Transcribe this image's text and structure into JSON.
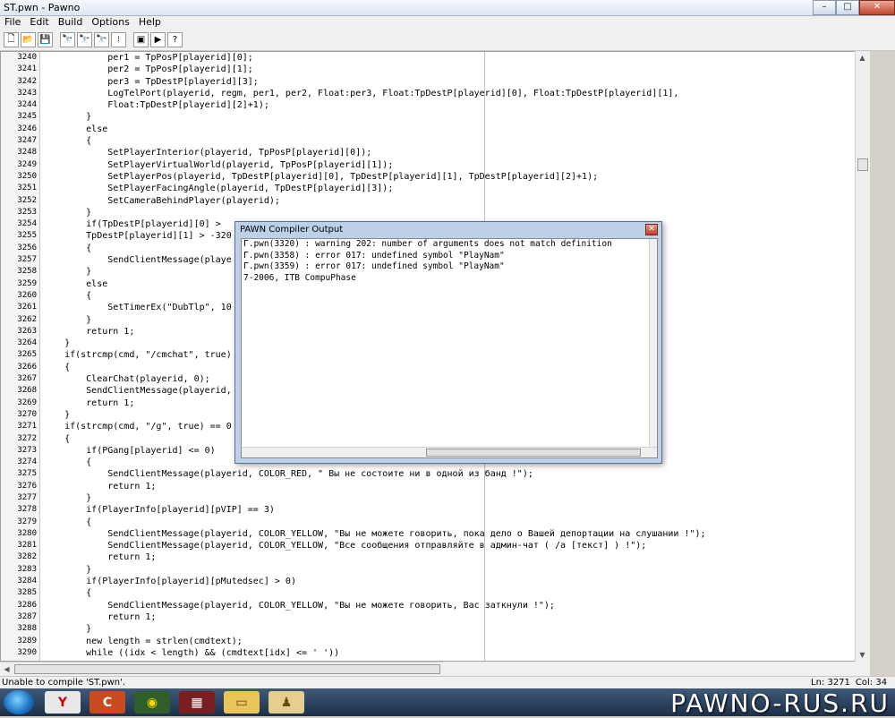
{
  "window": {
    "title": "ST.pwn - Pawno",
    "min_label": "–",
    "max_label": "□",
    "close_label": "✕"
  },
  "menu": [
    "File",
    "Edit",
    "Build",
    "Options",
    "Help"
  ],
  "toolbar": {
    "buttons": [
      {
        "name": "new-file-icon",
        "glyph": "🗋"
      },
      {
        "name": "open-folder-icon",
        "glyph": "📂"
      },
      {
        "name": "save-icon",
        "glyph": "💾"
      },
      {
        "name": "find-icon",
        "glyph": "🔭"
      },
      {
        "name": "find-next-icon",
        "glyph": "🔭"
      },
      {
        "name": "replace-icon",
        "glyph": "🔭"
      },
      {
        "name": "goto-line-icon",
        "glyph": "⁝"
      },
      {
        "name": "compile-icon",
        "glyph": "▣"
      },
      {
        "name": "run-icon",
        "glyph": "▶"
      },
      {
        "name": "help-icon",
        "glyph": "?"
      }
    ]
  },
  "editor": {
    "lines": [
      {
        "n": "3240",
        "t": "            per1 = TpPosP[playerid][0];"
      },
      {
        "n": "3241",
        "t": "            per2 = TpPosP[playerid][1];"
      },
      {
        "n": "3242",
        "t": "            per3 = TpDestP[playerid][3];"
      },
      {
        "n": "3243",
        "t": "            LogTelPort(playerid, regm, per1, per2, Float:per3, Float:TpDestP[playerid][0], Float:TpDestP[playerid][1],"
      },
      {
        "n": "3244",
        "t": "            Float:TpDestP[playerid][2]+1);"
      },
      {
        "n": "3245",
        "t": "        }"
      },
      {
        "n": "3246",
        "t": "        else"
      },
      {
        "n": "3247",
        "t": "        {"
      },
      {
        "n": "3248",
        "t": "            SetPlayerInterior(playerid, TpPosP[playerid][0]);"
      },
      {
        "n": "3249",
        "t": "            SetPlayerVirtualWorld(playerid, TpPosP[playerid][1]);"
      },
      {
        "n": "3250",
        "t": "            SetPlayerPos(playerid, TpDestP[playerid][0], TpDestP[playerid][1], TpDestP[playerid][2]+1);"
      },
      {
        "n": "3251",
        "t": "            SetPlayerFacingAngle(playerid, TpDestP[playerid][3]);"
      },
      {
        "n": "3252",
        "t": "            SetCameraBehindPlayer(playerid);"
      },
      {
        "n": "3253",
        "t": "        }"
      },
      {
        "n": "3254",
        "t": "        if(TpDestP[playerid][0] >"
      },
      {
        "n": "3255",
        "t": "        TpDestP[playerid][1] > -320"
      },
      {
        "n": "3256",
        "t": "        {"
      },
      {
        "n": "3257",
        "t": "            SendClientMessage(playe"
      },
      {
        "n": "3258",
        "t": "        }"
      },
      {
        "n": "3259",
        "t": "        else"
      },
      {
        "n": "3260",
        "t": "        {"
      },
      {
        "n": "3261",
        "t": "            SetTimerEx(\"DubTlp\", 10"
      },
      {
        "n": "3262",
        "t": "        }"
      },
      {
        "n": "3263",
        "t": "        return 1;"
      },
      {
        "n": "3264",
        "t": "    }"
      },
      {
        "n": "3265",
        "t": "    if(strcmp(cmd, \"/cmchat\", true)"
      },
      {
        "n": "3266",
        "t": "    {"
      },
      {
        "n": "3267",
        "t": "        ClearChat(playerid, 0);"
      },
      {
        "n": "3268",
        "t": "        SendClientMessage(playerid,"
      },
      {
        "n": "3269",
        "t": "        return 1;"
      },
      {
        "n": "3270",
        "t": "    }"
      },
      {
        "n": "3271",
        "t": "    if(strcmp(cmd, \"/g\", true) == 0"
      },
      {
        "n": "3272",
        "t": "    {"
      },
      {
        "n": "3273",
        "t": "        if(PGang[playerid] <= 0)"
      },
      {
        "n": "3274",
        "t": "        {"
      },
      {
        "n": "3275",
        "t": "            SendClientMessage(playerid, COLOR_RED, \" Вы не состоите ни в одной из банд !\");"
      },
      {
        "n": "3276",
        "t": "            return 1;"
      },
      {
        "n": "3277",
        "t": "        }"
      },
      {
        "n": "3278",
        "t": "        if(PlayerInfo[playerid][pVIP] == 3)"
      },
      {
        "n": "3279",
        "t": "        {"
      },
      {
        "n": "3280",
        "t": "            SendClientMessage(playerid, COLOR_YELLOW, \"Вы не можете говорить, пока дело о Вашей депортации на слушании !\");"
      },
      {
        "n": "3281",
        "t": "            SendClientMessage(playerid, COLOR_YELLOW, \"Все сообщения отправляйте в админ-чат ( /a [текст] ) !\");"
      },
      {
        "n": "3282",
        "t": "            return 1;"
      },
      {
        "n": "3283",
        "t": "        }"
      },
      {
        "n": "3284",
        "t": "        if(PlayerInfo[playerid][pMutedsec] > 0)"
      },
      {
        "n": "3285",
        "t": "        {"
      },
      {
        "n": "3286",
        "t": "            SendClientMessage(playerid, COLOR_YELLOW, \"Вы не можете говорить, Вас заткнули !\");"
      },
      {
        "n": "3287",
        "t": "            return 1;"
      },
      {
        "n": "3288",
        "t": "        }"
      },
      {
        "n": "3289",
        "t": "        new length = strlen(cmdtext);"
      },
      {
        "n": "3290",
        "t": "        while ((idx < length) && (cmdtext[idx] <= ' '))"
      }
    ]
  },
  "compiler": {
    "title": "PAWN Compiler Output",
    "close_label": "✕",
    "lines": [
      "Г.pwn(3320) : warning 202: number of arguments does not match definition",
      "Г.pwn(3358) : error 017: undefined symbol \"PlayNam\"",
      "Г.pwn(3359) : error 017: undefined symbol \"PlayNam\"",
      "7-2006, ITB CompuPhase"
    ]
  },
  "status": {
    "message": "Unable to compile 'ST.pwn'.",
    "line": "Ln: 3271",
    "col": "Col: 34"
  },
  "taskbar": {
    "watermark": "PAWNO-RUS.RU"
  }
}
